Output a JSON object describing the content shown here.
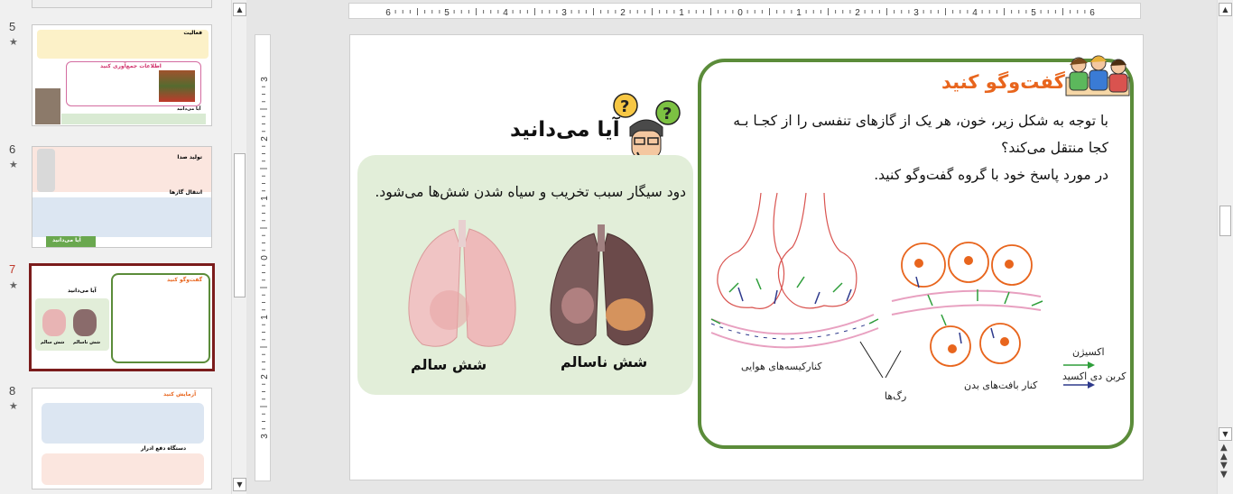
{
  "thumbnails": [
    {
      "number": "5",
      "star": "★",
      "heading_1": "فعالیت",
      "heading_2": "اطلاعات جمع‌آوری کنید",
      "heading_3": "آیا می‌دانید"
    },
    {
      "number": "6",
      "star": "★",
      "heading_1": "تولید صدا",
      "heading_2": "انتقال گازها",
      "heading_3": "آیا می‌دانید"
    },
    {
      "number": "7",
      "star": "★",
      "heading_1": "گفت‌وگو کنید",
      "heading_2": "آیا می‌دانید",
      "heading_3": "شش سالم",
      "heading_4": "شش ناسالم"
    },
    {
      "number": "8",
      "star": "★",
      "heading_1": "آزمایش کنید",
      "heading_2": "دستگاه دفع ادرار"
    }
  ],
  "ruler": {
    "horizontal": [
      "6",
      "5",
      "4",
      "3",
      "2",
      "1",
      "0",
      "1",
      "2",
      "3",
      "4",
      "5",
      "6"
    ],
    "vertical": [
      "3",
      "2",
      "1",
      "0",
      "1",
      "2",
      "3"
    ]
  },
  "slide": {
    "talk": {
      "title": "گفت‌وگو کنید",
      "line1": "با توجه به شکل زیر، خون، هر یک از گازهای تنفسی را از کجـا بـه",
      "line2": "کجا منتقل می‌کند؟",
      "line3": "در مورد پاسخ خود با گروه گفت‌وگو کنید."
    },
    "know": {
      "title": "آیا می‌دانید",
      "text": "دود سیگار سبب تخریب و سیاه شدن شش‌ها می‌شود.",
      "healthy_label": "شش سالم",
      "unhealthy_label": "شش ناسالم"
    },
    "diagram": {
      "alveoli_label": "کنارکیسه‌های هوایی",
      "tissue_label": "کنار بافت‌های بدن",
      "vessels_label": "رگ‌ها",
      "oxygen_label": "اکسیژن",
      "co2_label": "کربن دی اکسید"
    }
  },
  "colors": {
    "accent_orange": "#e8651d",
    "frame_green": "#5b8c3a",
    "box_green": "#e2eed9",
    "active_thumb": "#7b1c1c"
  }
}
